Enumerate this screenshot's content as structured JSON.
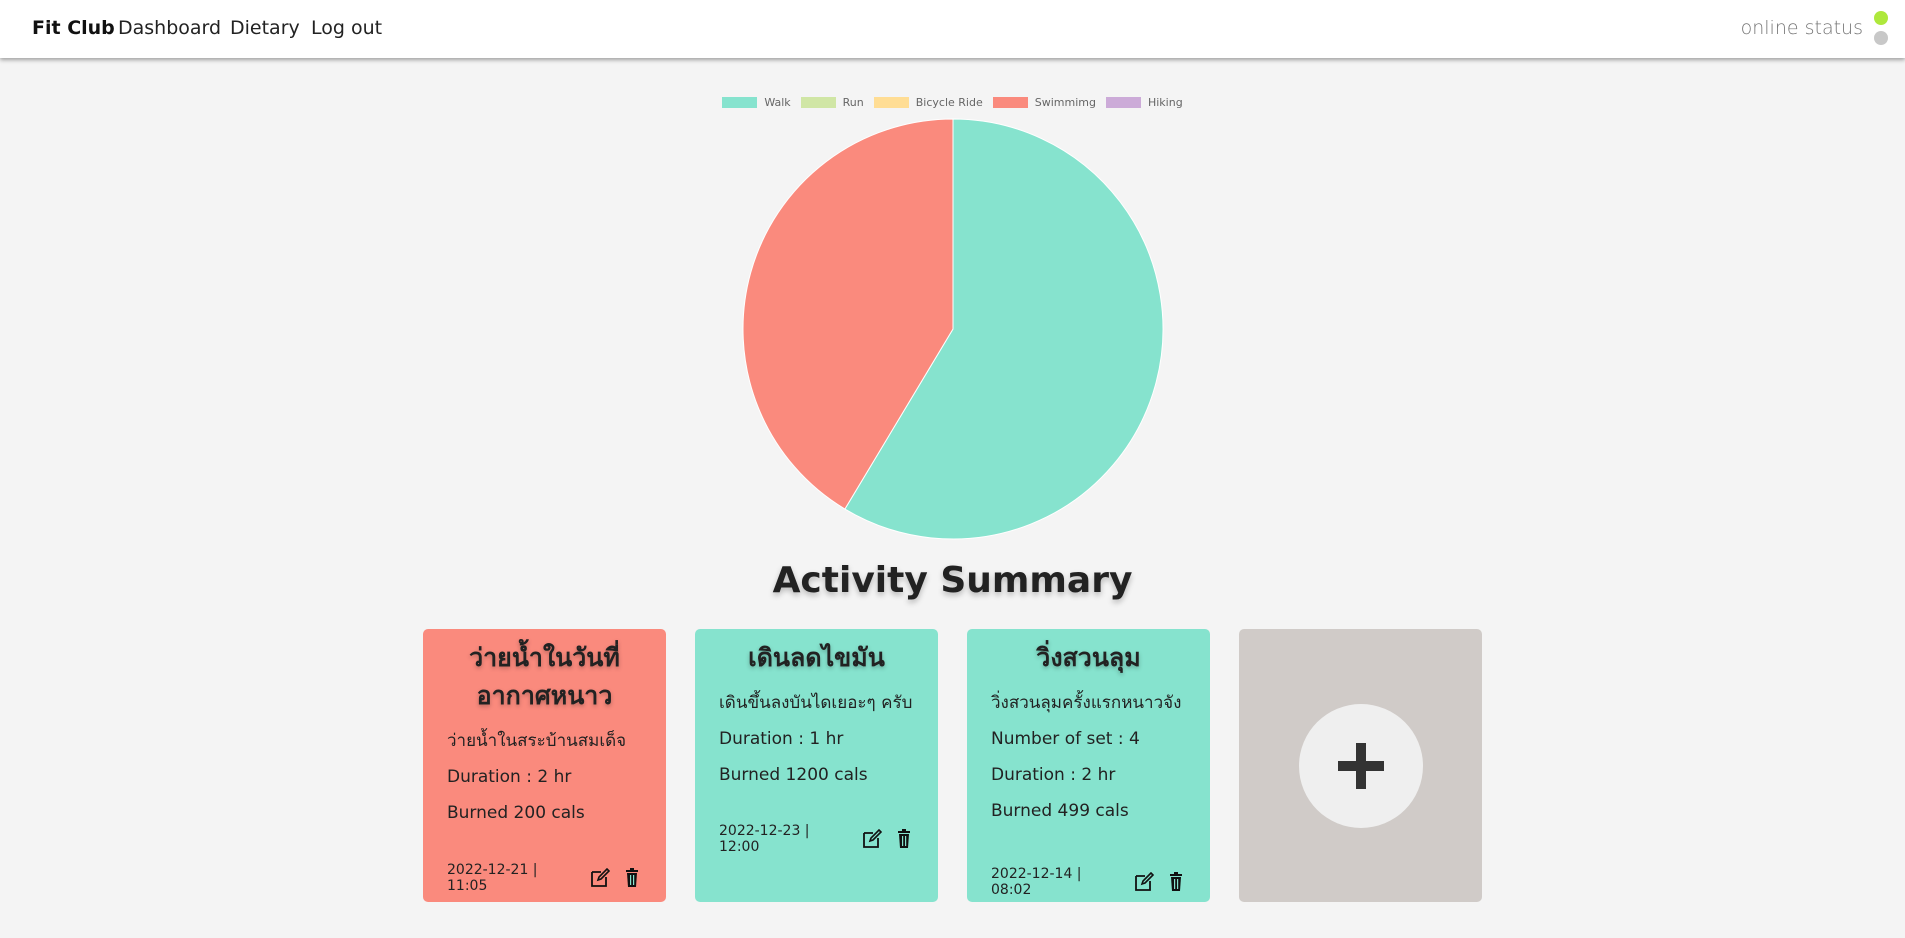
{
  "nav": {
    "brand": "Fit Club",
    "dashboard": "Dashboard",
    "dietary": "Dietary",
    "logout": "Log out",
    "status_label": "online status"
  },
  "colors": {
    "walk": "#86e3ce",
    "run": "#d0e6a5",
    "bicycle": "#ffdd94",
    "swimming": "#fa8a7d",
    "hiking": "#ccabd8",
    "online": "#aee83c"
  },
  "chart_data": {
    "type": "pie",
    "categories": [
      "Walk",
      "Run",
      "Bicycle Ride",
      "Swimmimg",
      "Hiking"
    ],
    "values": [
      1699,
      0,
      0,
      1200,
      0
    ],
    "legend": "top"
  },
  "summary_title": "Activity Summary",
  "cards": [
    {
      "title": "ว่ายน้ำในวันที่อากาศหนาว",
      "description": "ว่ายน้ำในสระบ้านสมเด็จ",
      "duration": "Duration : 2 hr",
      "burned": "Burned 200 cals",
      "date": "2022-12-21 | 11:05"
    },
    {
      "title": "เดินลดไขมัน",
      "description": "เดินขึ้นลงบันไดเยอะๆ ครับ",
      "duration": "Duration : 1 hr",
      "burned": "Burned 1200 cals",
      "date": "2022-12-23 | 12:00"
    },
    {
      "title": "วิ่งสวนลุม",
      "description": "วิ่งสวนลุมครั้งแรกหนาวจัง",
      "sets": "Number of set : 4",
      "duration": "Duration : 2 hr",
      "burned": "Burned 499 cals",
      "date": "2022-12-14 | 08:02"
    }
  ],
  "icons": {
    "edit": "edit-icon",
    "delete": "trash-icon",
    "add": "plus-icon"
  }
}
